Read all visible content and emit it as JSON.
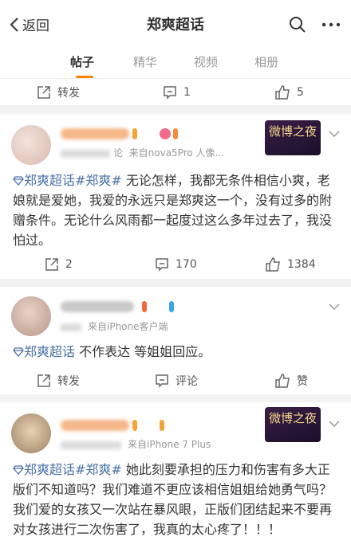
{
  "header": {
    "back_label": "返回",
    "title": "郑爽超话"
  },
  "tabs": [
    {
      "label": "帖子",
      "active": true
    },
    {
      "label": "精华",
      "active": false
    },
    {
      "label": "视频",
      "active": false
    },
    {
      "label": "相册",
      "active": false
    }
  ],
  "top_actions": {
    "repost": "转发",
    "comments": "1",
    "likes": "5"
  },
  "posts": [
    {
      "device": "来自nova5Pro 人像...",
      "meta_prefix": "论",
      "topic": "郑爽超话#郑爽#",
      "text": " 无论怎样，我都无条件相信小爽，老娘就是爱她，我爱的永远只是郑爽这一个，没有过多的附赠条件。无论什么风雨都一起度过这么多年过去了，我没怕过。",
      "stamp": "微博之夜",
      "actions": {
        "repost": "2",
        "comments": "170",
        "likes": "1384"
      }
    },
    {
      "device": "来自iPhone客户端",
      "topic": "郑爽超话",
      "text": " 不作表达 等姐姐回应。",
      "actions": {
        "repost": "转发",
        "comments": "评论",
        "likes": "赞"
      }
    },
    {
      "device": "来自iPhone 7 Plus",
      "topic": "郑爽超话#郑爽#",
      "text": " 她此刻要承担的压力和伤害有多大正版们不知道吗？我们难道不更应该相信姐姐给她勇气吗？我们爱的女孩又一次站在暴风眼，正版们团结起来不要再对女孩进行二次伤害了，我真的太心疼了！！！",
      "stamp": "微博之夜"
    }
  ],
  "colors": {
    "accent": "#ff8200",
    "topic": "#4a6fa5"
  }
}
